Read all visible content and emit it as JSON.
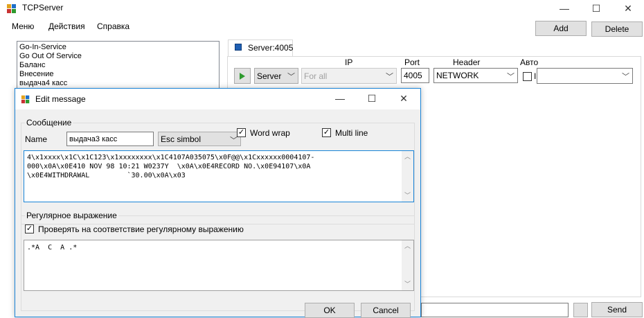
{
  "window": {
    "title": "TCPServer",
    "min_glyph": "—",
    "max_glyph": "☐",
    "close_glyph": "✕"
  },
  "menu": [
    "Меню",
    "Действия",
    "Справка"
  ],
  "toolbar": {
    "add": "Add",
    "delete": "Delete"
  },
  "list": [
    "Go-In-Service",
    "Go Out Of Service",
    "Баланс",
    "Внесение",
    "выдача4 касс"
  ],
  "tab": {
    "label": "Server:4005"
  },
  "server": {
    "headers": {
      "ip": "IP",
      "port": "Port",
      "header": "Header",
      "auto": "Авто"
    },
    "mode": "Server",
    "ip": "For all",
    "port": "4005",
    "header": "NETWORK",
    "auto_checked": false,
    "auto_partial": "I"
  },
  "bottom": {
    "send": "Send"
  },
  "dialog": {
    "title": "Edit message",
    "message_group": "Сообщение",
    "name_label": "Name",
    "name_value": "выдача3 касс",
    "encoding": "Esc simbol",
    "word_wrap": "Word wrap",
    "word_wrap_checked": true,
    "multi_line": "Multi line",
    "multi_line_checked": true,
    "message_text": "4\\x1xxxx\\x1C\\x1C123\\x1xxxxxxxx\\x1C4107A035075\\x0F@@\\x1Cxxxxxx0004107-\n000\\x0A\\x0E410 NOV 98 10:21 W0237Y  \\x0A\\x0E4RECORD NO.\\x0E94107\\x0A\n\\x0E4WITHDRAWAL         `30.00\\x0A\\x03",
    "regex_group": "Регулярное выражение",
    "regex_check_label": "Проверять на соответствие регулярному выражению",
    "regex_checked": true,
    "regex_text": ".*A  C  A .*",
    "ok": "OK",
    "cancel": "Cancel"
  },
  "colors": {
    "accent": "#1883d7",
    "button": "#e1e1e1",
    "play": "#2e9a2e"
  }
}
